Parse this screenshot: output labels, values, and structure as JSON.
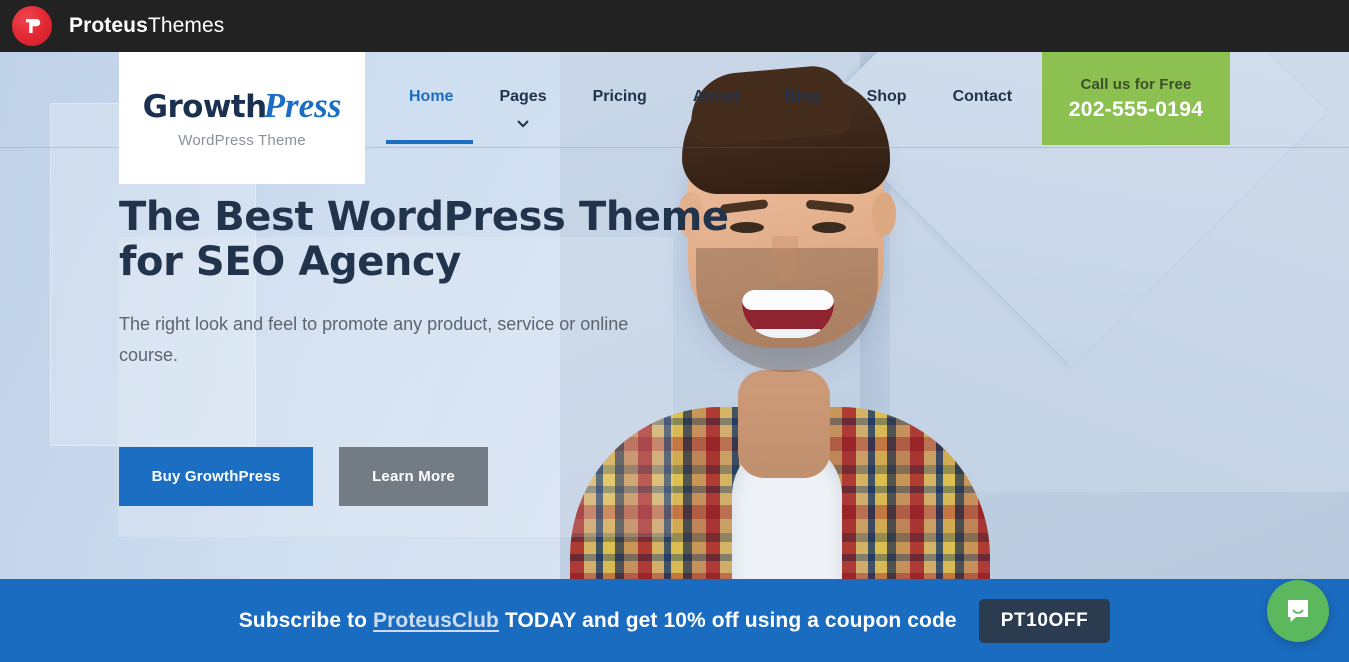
{
  "topbar": {
    "logo_icon": "proteus-monogram-icon",
    "brand_strong": "Proteus",
    "brand_light": "Themes"
  },
  "site_logo": {
    "word_part1": "Growth",
    "word_part2": "Press",
    "subtitle": "WordPress Theme"
  },
  "nav": {
    "items": [
      {
        "label": "Home",
        "active": true,
        "has_caret": false
      },
      {
        "label": "Pages",
        "active": false,
        "has_caret": true,
        "caret_icon": "chevron-down-icon"
      },
      {
        "label": "Pricing",
        "active": false,
        "has_caret": false
      },
      {
        "label": "About",
        "active": false,
        "has_caret": false
      },
      {
        "label": "Blog",
        "active": false,
        "has_caret": false
      },
      {
        "label": "Shop",
        "active": false,
        "has_caret": false
      },
      {
        "label": "Contact",
        "active": false,
        "has_caret": false
      }
    ],
    "active_color": "#1b6ec2",
    "text_color": "#22334c"
  },
  "callbox": {
    "label": "Call us for Free",
    "number": "202-555-0194",
    "background": "#8cc152"
  },
  "hero": {
    "title_line1": "The Best WordPress Theme",
    "title_line2": "for SEO Agency",
    "subtitle": "The right look and feel to promote any product, service or online course.",
    "primary_button": "Buy GrowthPress",
    "secondary_button": "Learn More",
    "primary_color": "#1b6ec2",
    "secondary_color": "#737b85",
    "image_alt": "smiling-man-photo"
  },
  "subscribe": {
    "text_before": "Subscribe to ",
    "link": "ProteusClub",
    "text_after": " TODAY and get 10% off using a coupon code",
    "coupon_code": "PT10OFF",
    "background": "#1a6cc1",
    "coupon_background": "#2b3b50"
  },
  "chat": {
    "icon": "chat-bubble-icon",
    "background": "#5bb85c"
  }
}
